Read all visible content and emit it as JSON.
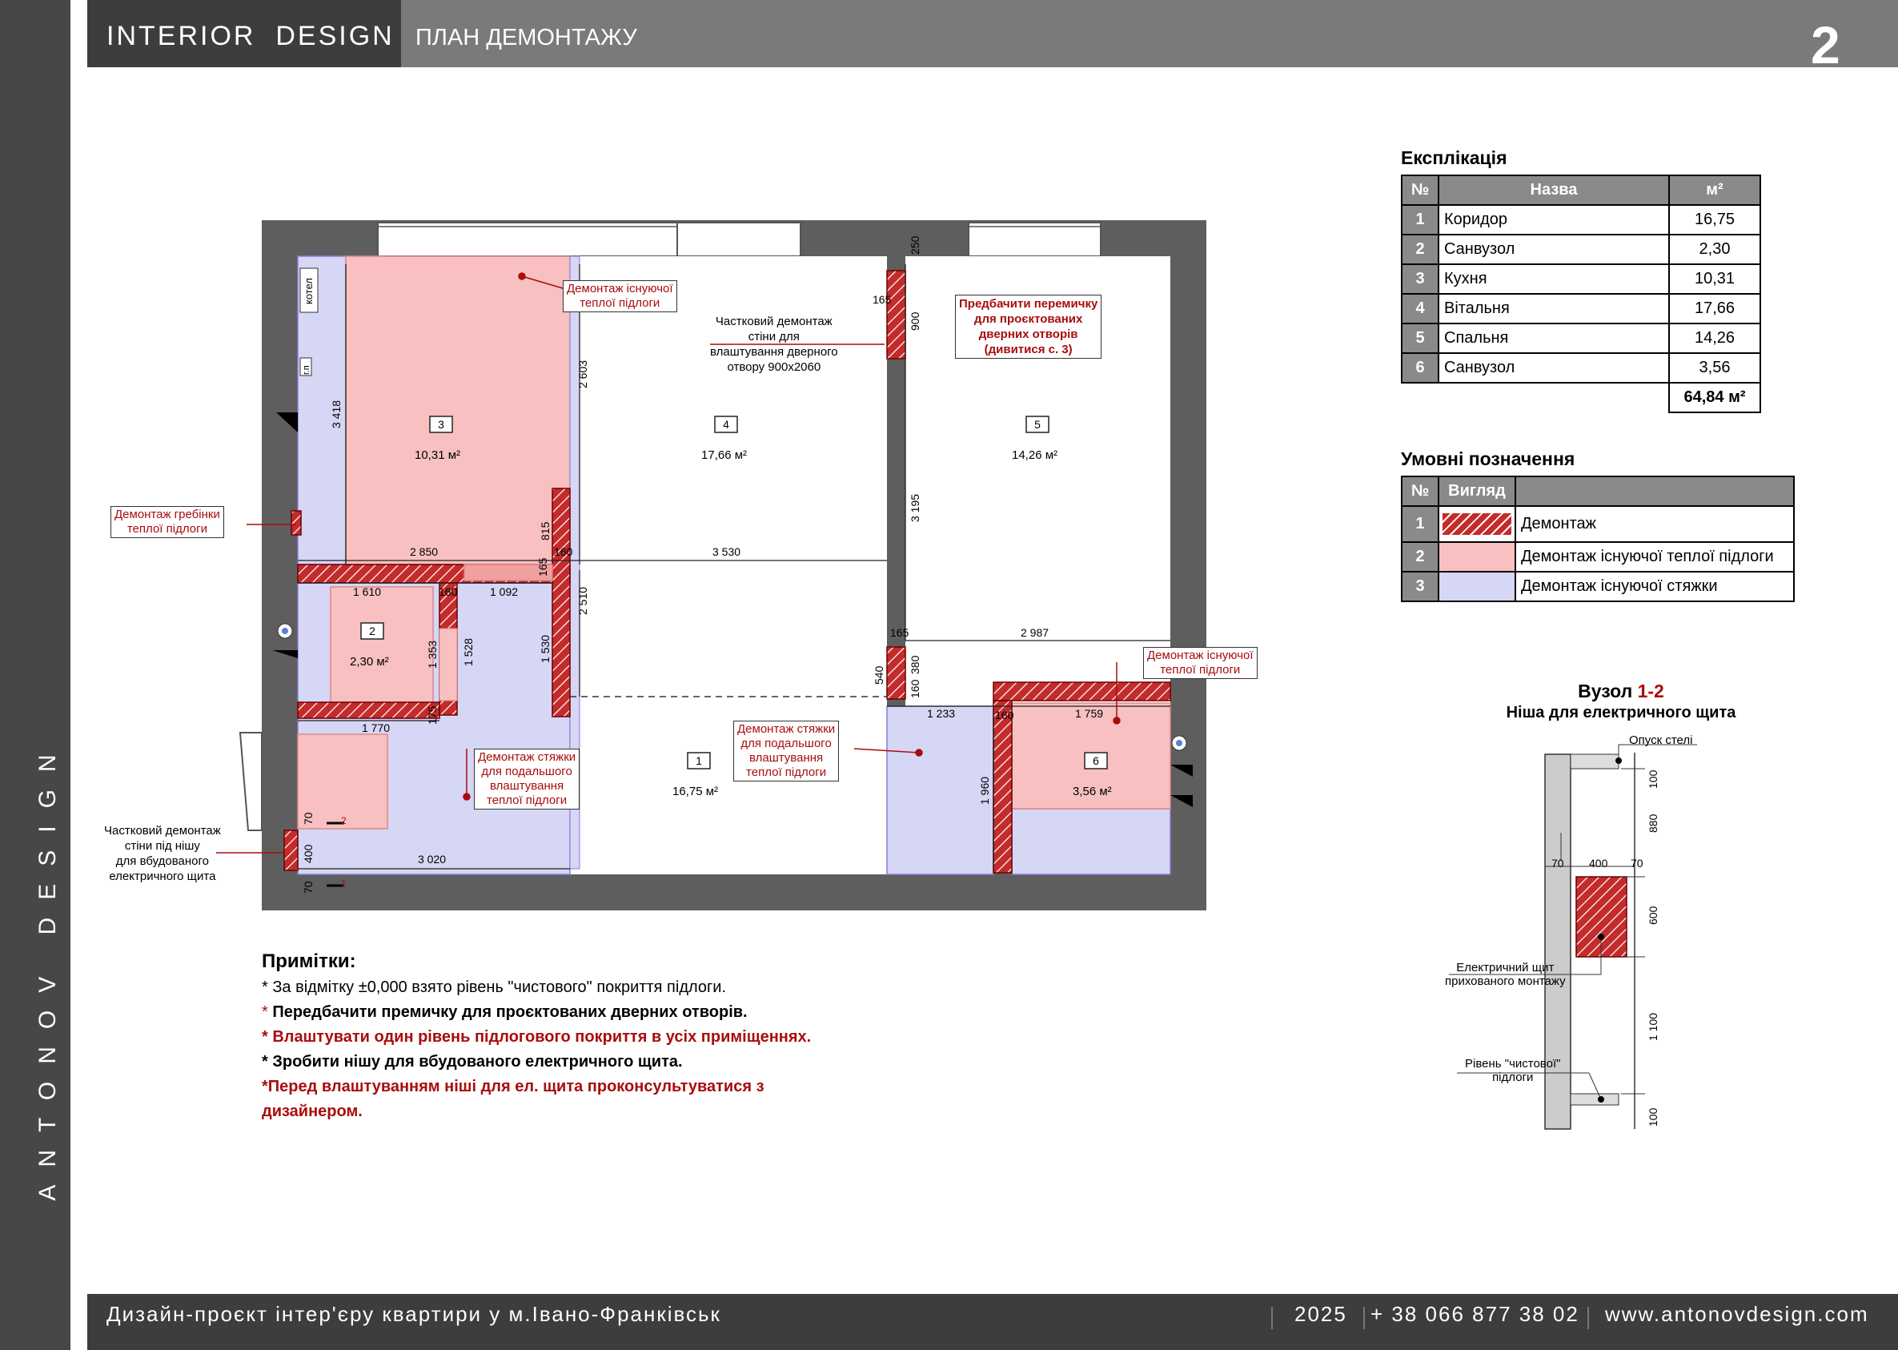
{
  "header": {
    "brand": "INTERIOR  DESIGN",
    "title": "ПЛАН ДЕМОНТАЖУ",
    "page_number": "2"
  },
  "sidebar": {
    "text": "ANTONOV DESIGN"
  },
  "footer": {
    "project": "Дизайн-проєкт інтер'єру квартири у м.Івано-Франківськ",
    "year": "2025",
    "phone": "+ 38 066 877 38 02",
    "site": "www.antonovdesign.com"
  },
  "colors": {
    "demolition": "#c42b2b",
    "floor_heating": "#f8c0c0",
    "screed": "#d6d6f5",
    "wall": "#5e5e5e",
    "accent": "#a80d0d"
  },
  "explication": {
    "title": "Експлікація",
    "headers": [
      "№",
      "Назва",
      "м²"
    ],
    "rows": [
      [
        "1",
        "Коридор",
        "16,75"
      ],
      [
        "2",
        "Санвузол",
        "2,30"
      ],
      [
        "3",
        "Кухня",
        "10,31"
      ],
      [
        "4",
        "Вітальня",
        "17,66"
      ],
      [
        "5",
        "Спальня",
        "14,26"
      ],
      [
        "6",
        "Санвузол",
        "3,56"
      ]
    ],
    "total": "64,84 м²"
  },
  "legend": {
    "title": "Умовні позначення",
    "headers": [
      "№",
      "Вигляд"
    ],
    "rows": [
      [
        "1",
        "Демонтаж"
      ],
      [
        "2",
        "Демонтаж існуючої теплої підлоги"
      ],
      [
        "3",
        "Демонтаж існуючої стяжки"
      ]
    ]
  },
  "node": {
    "title_prefix": "Вузол ",
    "title_id": "1-2",
    "subtitle": "Ніша для електричного щита",
    "labels": {
      "ceiling": "Опуск стелі",
      "panel": "Електричний щит\nприхованого монтажу",
      "floor": "Рівень \"чистової\"\nпідлоги"
    },
    "dims": {
      "top": "100",
      "a": "880",
      "b": "600",
      "c": "1 100",
      "bottom": "100",
      "w1": "70",
      "w2": "400",
      "w3": "70"
    }
  },
  "notes": {
    "title": "Примітки:",
    "items": [
      {
        "text": "* За відмітку ±0,000 взято рівень \"чистового\" покриття підлоги."
      },
      {
        "star": "* ",
        "text": "Передбачити премичку для проєктованих дверних отворів."
      },
      {
        "text": "* Влаштувати один рівень підлогового покриття в усіх приміщеннях."
      },
      {
        "text": "* Зробити нішу для вбудованого електричного щита."
      },
      {
        "text": "*Перед влаштуванням ніші для ел. щита проконсультуватися з"
      },
      {
        "text": "дизайнером."
      }
    ]
  },
  "plan": {
    "rooms": [
      {
        "id": "1",
        "area": "16,75 м²"
      },
      {
        "id": "2",
        "area": "2,30 м²"
      },
      {
        "id": "3",
        "area": "10,31 м²"
      },
      {
        "id": "4",
        "area": "17,66 м²"
      },
      {
        "id": "5",
        "area": "14,26 м²"
      },
      {
        "id": "6",
        "area": "3,56 м²"
      }
    ],
    "callouts": {
      "heated_floor_top": "Демонтаж існуючої\nтеплої підлоги",
      "partial_wall_door": "Частковий демонтаж\nстіни для\nвлаштування дверного\nотвору 900х2060",
      "lintel": "Предбачити перемичку\nдля проєктованих\nдверних отворів\n(дивитися с. 3)",
      "comb": "Демонтаж гребінки\nтеплої підлоги",
      "screed_left": "Демонтаж стяжки\nдля подальшого\nвлаштування\nтеплої підлоги",
      "screed_center": "Демонтаж стяжки\nдля подальшого\nвлаштування\nтеплої підлоги",
      "heated_floor_right": "Демонтаж існуючої\nтеплої підлоги",
      "partial_wall_niche": "Частковий демонтаж\nстіни під нішу\nдля вбудованого\nелектричного щита"
    },
    "tags": {
      "boiler": "котел",
      "kp": "г.п",
      "v1": "1",
      "v2": "2"
    },
    "dims": [
      "3 418",
      "2 850",
      "3 530",
      "2 603",
      "2 510",
      "1 530",
      "815",
      "160",
      "165",
      "1 610",
      "160",
      "1 092",
      "1 353",
      "1 528",
      "175",
      "1 770",
      "3 020",
      "70",
      "400",
      "70",
      "250",
      "165",
      "900",
      "3 195",
      "165",
      "2 987",
      "540",
      "160",
      "380",
      "1 233",
      "160",
      "1 759",
      "1 960"
    ]
  }
}
